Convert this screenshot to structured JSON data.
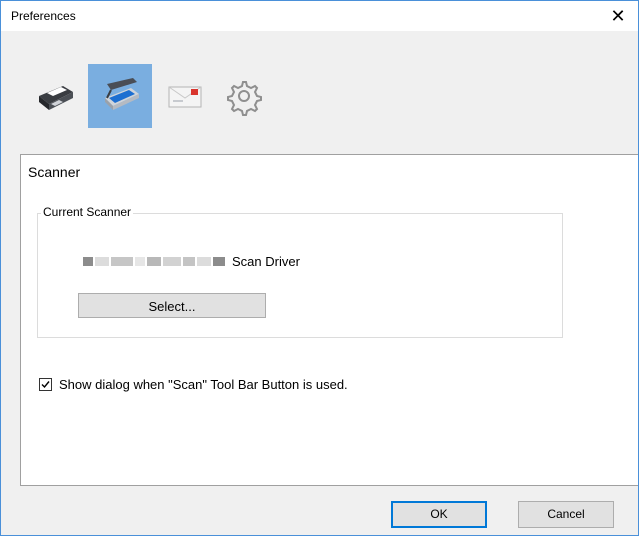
{
  "window": {
    "title": "Preferences",
    "close_symbol": "✕"
  },
  "toolbar": {
    "tools": [
      {
        "name": "printer",
        "icon": "printer-icon",
        "selected": false
      },
      {
        "name": "scanner",
        "icon": "scanner-icon",
        "selected": true
      },
      {
        "name": "email",
        "icon": "envelope-icon",
        "selected": false
      },
      {
        "name": "settings",
        "icon": "gear-icon",
        "selected": false
      }
    ],
    "selected_color": "#7aaee0"
  },
  "panel": {
    "title": "Scanner",
    "group": {
      "legend": "Current Scanner",
      "driver_suffix": "Scan Driver",
      "select_label": "Select..."
    },
    "checkbox": {
      "checked": true,
      "label": "Show dialog when \"Scan\" Tool Bar Button is used."
    }
  },
  "footer": {
    "ok_label": "OK",
    "cancel_label": "Cancel"
  }
}
